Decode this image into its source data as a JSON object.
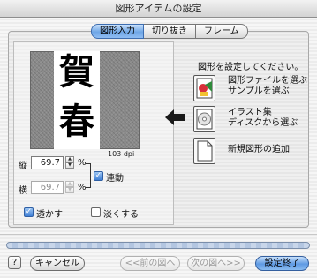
{
  "window": {
    "title": "図形アイテムの設定"
  },
  "tabs": [
    {
      "label": "図形入力",
      "active": true
    },
    {
      "label": "切り抜き",
      "active": false
    },
    {
      "label": "フレーム",
      "active": false
    }
  ],
  "preview": {
    "kanji_top": "賀",
    "kanji_bottom": "春",
    "resolution": "103 dpi"
  },
  "size": {
    "height_label": "縦",
    "height_value": "69.7",
    "width_label": "横",
    "width_value": "69.7",
    "unit": "%",
    "link_label": "連動",
    "link_checked": true
  },
  "options": {
    "transparent_label": "透かす",
    "transparent_checked": true,
    "light_label": "淡くする",
    "light_checked": false
  },
  "right": {
    "instruction": "図形を設定してください。",
    "choice1_line1": "図形ファイルを選ぶ",
    "choice1_line2": "サンプルを選ぶ",
    "choice2_line1": "イラスト集",
    "choice2_line2": "ディスクから選ぶ",
    "choice3": "新規図形の追加"
  },
  "footer": {
    "help": "?",
    "cancel": "キャンセル",
    "prev": "<<前の図へ",
    "next": "次の図へ>>",
    "done": "設定終了"
  },
  "colors": {
    "accent": "#5f9ae3",
    "tab_active": "#6fa6e6"
  }
}
